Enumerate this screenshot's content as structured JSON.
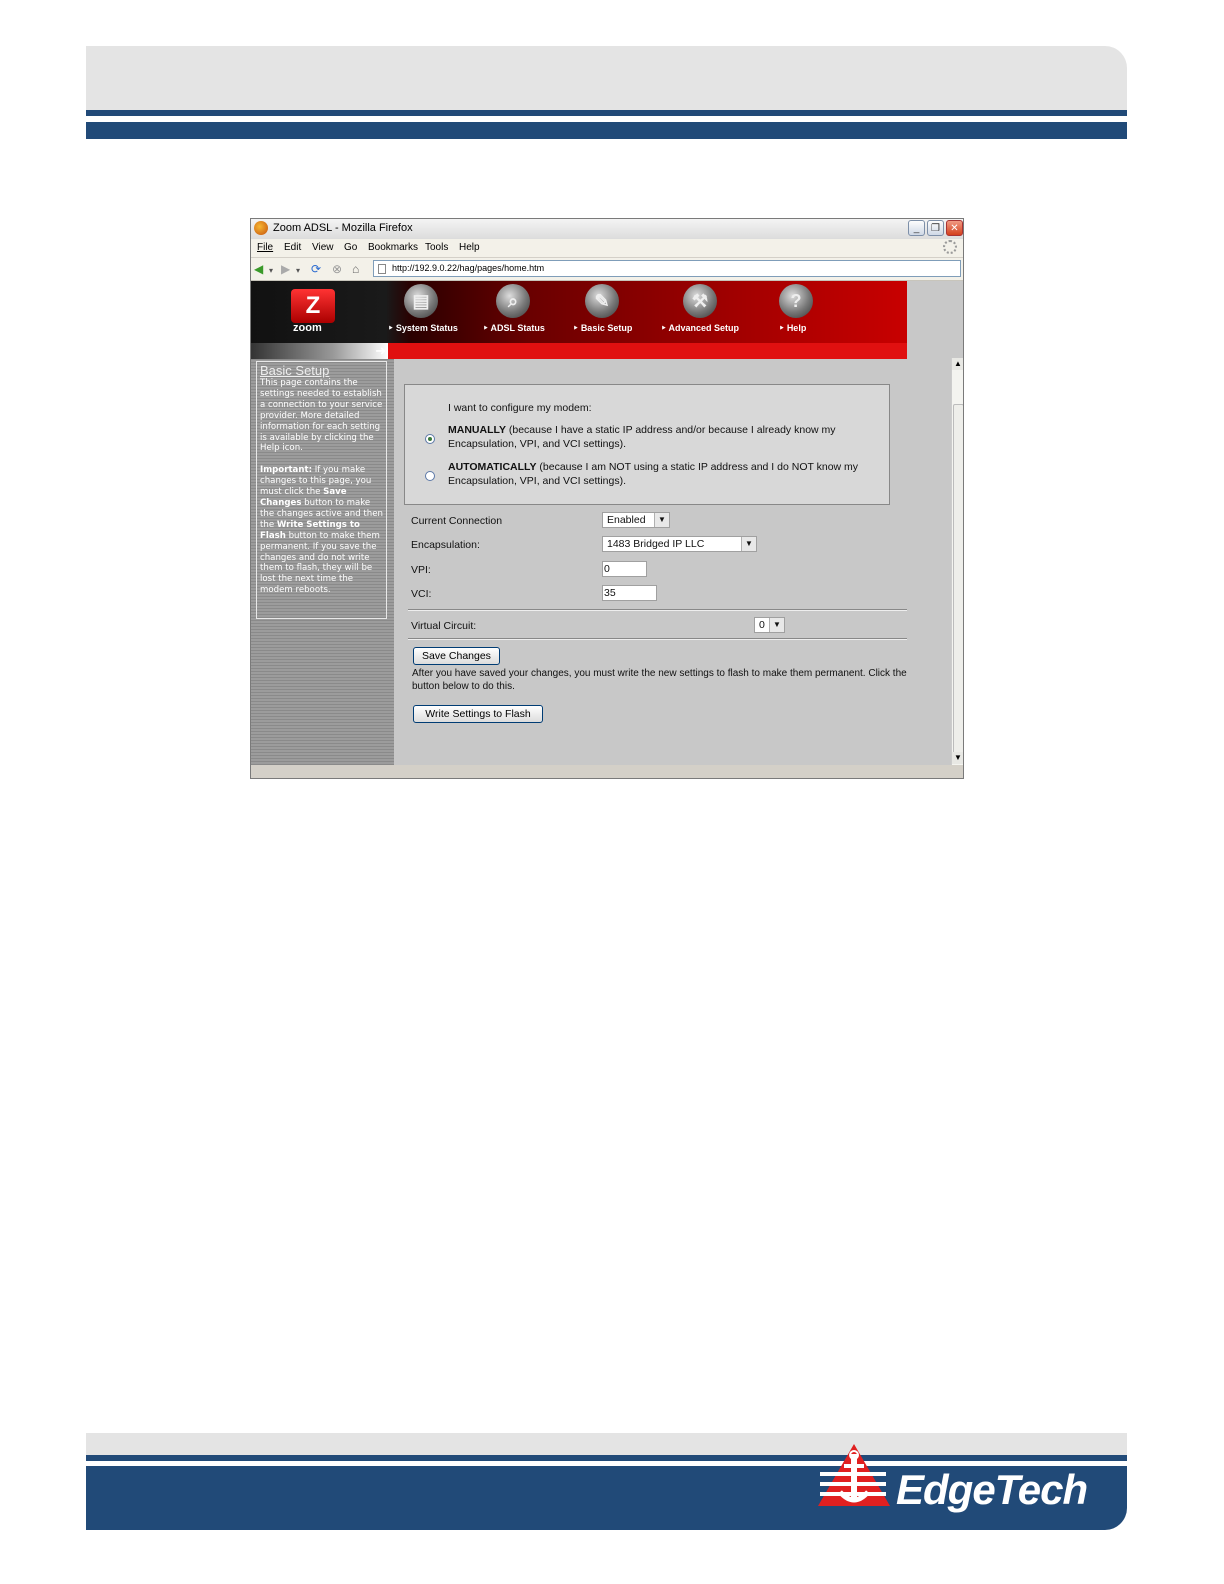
{
  "browser": {
    "title": "Zoom ADSL - Mozilla Firefox",
    "menu": [
      "File",
      "Edit",
      "View",
      "Go",
      "Bookmarks",
      "Tools",
      "Help"
    ],
    "url": "http://192.9.0.22/hag/pages/home.htm"
  },
  "banner": {
    "logo_text": "zoom",
    "nav": [
      "System Status",
      "ADSL Status",
      "Basic Setup",
      "Advanced Setup",
      "Help"
    ]
  },
  "sidebar": {
    "title": "Basic Setup",
    "intro": "This page contains the settings needed to establish a connection to your service provider. More detailed information for each setting is available by clicking the Help icon.",
    "important_label": "Important:",
    "important_1": " If you make changes to this page, you must click the ",
    "save_changes": "Save Changes",
    "important_2": " button to make the changes active and then the ",
    "write_settings": "Write Settings to Flash",
    "important_3": " button to make them permanent. If you save the changes and do not write them to flash, they will be lost the next time the modem reboots."
  },
  "config": {
    "prompt": "I want to configure my modem:",
    "manual_label": "MANUALLY",
    "manual_text": " (because I have a static IP address and/or because I already know my Encapsulation, VPI, and VCI settings).",
    "auto_label": "AUTOMATICALLY",
    "auto_text": " (because I am NOT using a static IP address and I do NOT know my Encapsulation, VPI, and VCI settings).",
    "selected": "manual"
  },
  "form": {
    "current_connection_label": "Current Connection",
    "current_connection_value": "Enabled",
    "encapsulation_label": "Encapsulation:",
    "encapsulation_value": "1483 Bridged IP LLC",
    "vpi_label": "VPI:",
    "vpi_value": "0",
    "vci_label": "VCI:",
    "vci_value": "35",
    "virtual_circuit_label": "Virtual Circuit:",
    "virtual_circuit_value": "0"
  },
  "actions": {
    "save_button": "Save Changes",
    "note": "After you have saved your changes, you must write the new settings to flash to make them permanent. Click the button below to do this.",
    "write_button": "Write Settings to Flash"
  },
  "footer": {
    "brand": "EdgeTech"
  },
  "colors": {
    "page_band": "#214a78",
    "band_gray": "#e4e4e4",
    "banner_red": "#c80000"
  }
}
